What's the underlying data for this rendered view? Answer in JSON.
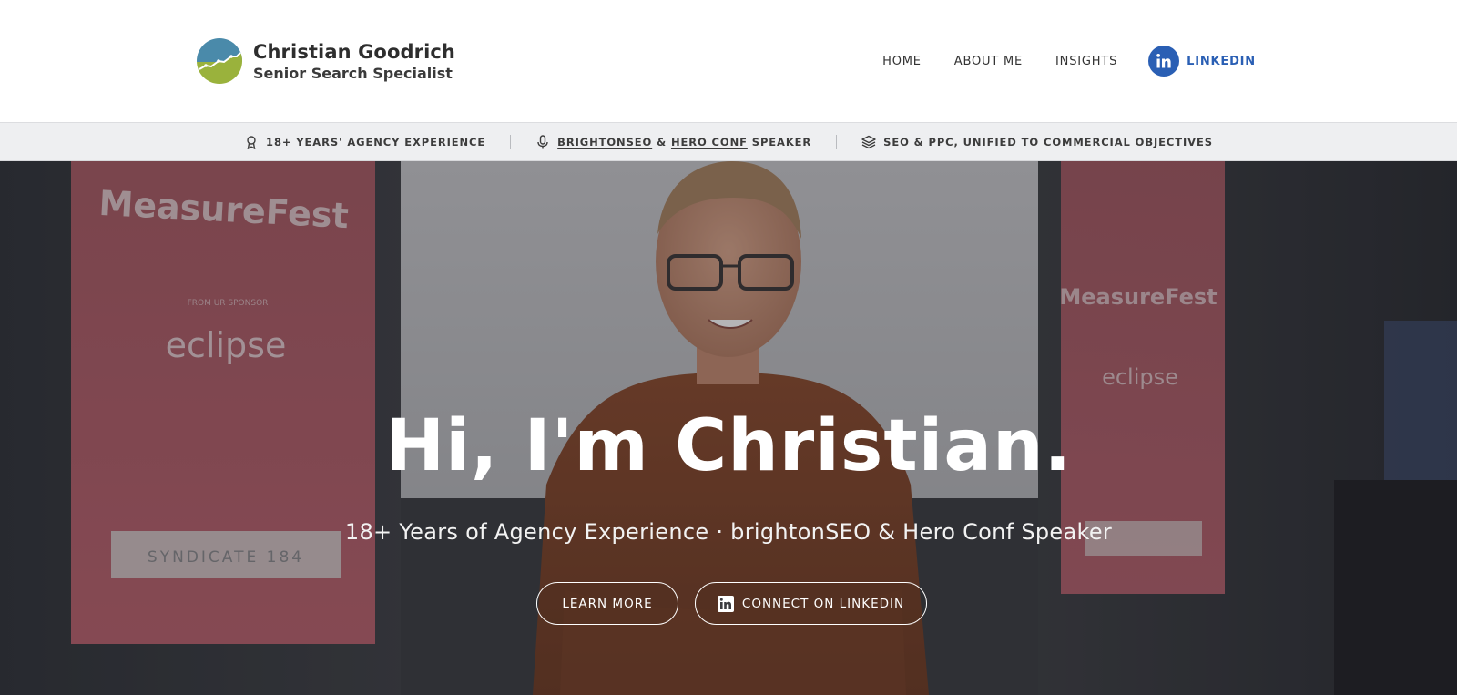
{
  "header": {
    "brand": {
      "name": "Christian Goodrich",
      "subtitle": "Senior Search Specialist",
      "logo_icon": "trend-chart-logo-icon"
    },
    "nav": {
      "items": [
        {
          "label": "HOME"
        },
        {
          "label": "ABOUT ME"
        },
        {
          "label": "INSIGHTS"
        }
      ],
      "linkedin_label": "LINKEDIN",
      "linkedin_icon": "linkedin-icon"
    }
  },
  "strip": {
    "item1": {
      "icon": "award-icon",
      "text": "18+ YEARS' AGENCY EXPERIENCE"
    },
    "item2": {
      "icon": "microphone-icon",
      "part1": "BRIGHTONSEO",
      "amp": " & ",
      "part2": "HERO CONF",
      "part3": " SPEAKER"
    },
    "item3": {
      "icon": "layers-icon",
      "text": "SEO & PPC, UNIFIED TO COMMERCIAL OBJECTIVES"
    }
  },
  "hero": {
    "title": "Hi, I'm Christian.",
    "subtitle": "18+ Years of Agency Experience · brightonSEO & Hero Conf Speaker",
    "buttons": {
      "learn_more": "LEARN MORE",
      "connect": "CONNECT ON LINKEDIN"
    },
    "banner_texts": {
      "brand": "MeasureFest",
      "presented": "FROM UR SPONSOR",
      "sponsor": "eclipse",
      "plate": "SYNDICATE 184"
    }
  },
  "colors": {
    "accent_blue": "#2a5fb4",
    "strip_bg": "#eeeff1",
    "logo_blue": "#4a8aaa",
    "logo_green": "#9ab23c"
  }
}
